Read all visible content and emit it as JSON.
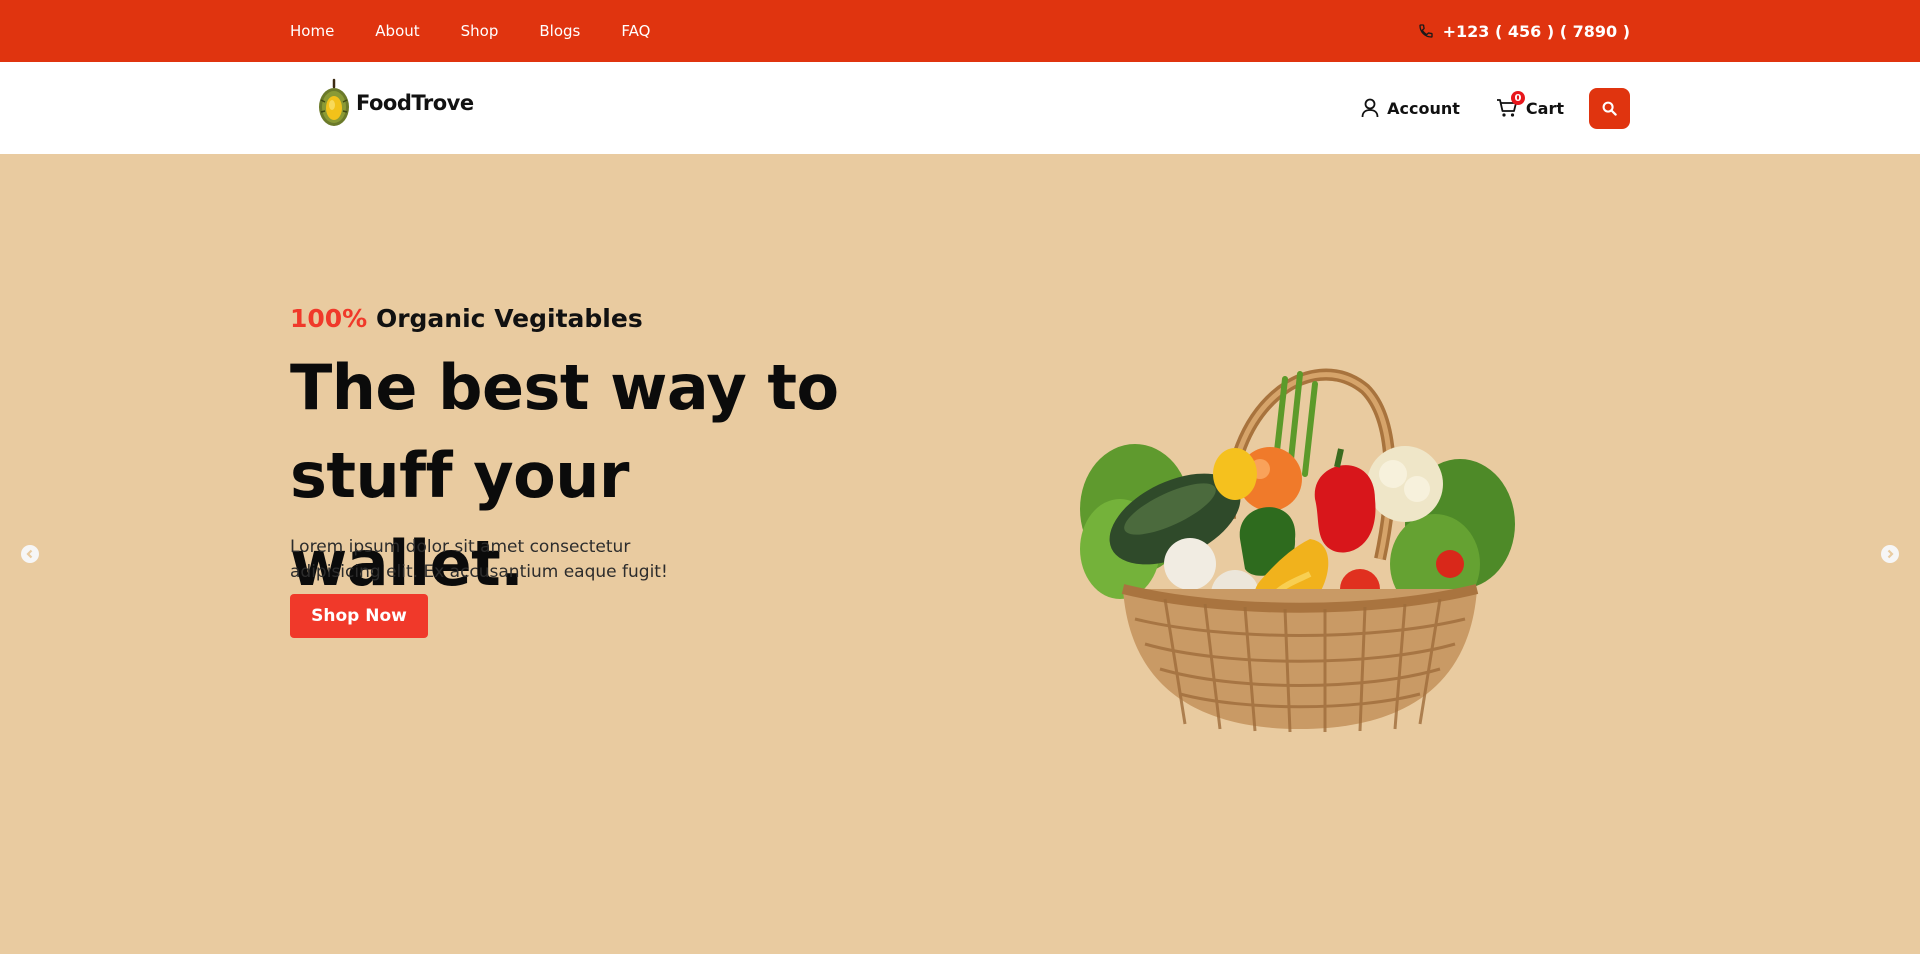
{
  "topbar": {
    "nav": [
      "Home",
      "About",
      "Shop",
      "Blogs",
      "FAQ"
    ],
    "phone": "+123 ( 456 ) ( 7890 )"
  },
  "header": {
    "logo_text": "FoodTrove",
    "account_label": "Account",
    "cart_label": "Cart",
    "cart_count": "0"
  },
  "hero": {
    "eyebrow_accent": "100%",
    "eyebrow_text": "Organic Vegitables",
    "headline_line1": "The best way to",
    "headline_line2": "stuff your wallet.",
    "description_line1": "Lorem ipsum dolor sit amet consectetur",
    "description_line2": "adipisicing elit. Ex accusantium eaque fugit!",
    "button_label": "Shop Now"
  },
  "colors": {
    "brand": "#e0340f",
    "accent": "#f0392a",
    "hero_bg": "#e9cba0"
  },
  "icons": [
    "phone-icon",
    "user-icon",
    "cart-icon",
    "search-icon",
    "chevron-left-icon",
    "chevron-right-icon",
    "durian-logo-icon"
  ]
}
